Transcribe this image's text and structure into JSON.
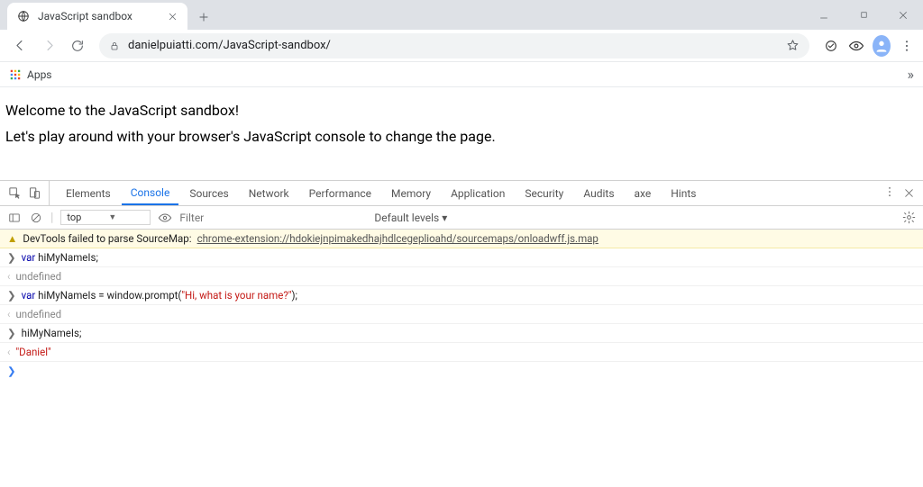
{
  "tab": {
    "title": "JavaScript sandbox"
  },
  "toolbar": {
    "url": "danielpuiatti.com/JavaScript-sandbox/"
  },
  "bookmarks": {
    "apps_label": "Apps"
  },
  "page": {
    "line1": "Welcome to the JavaScript sandbox!",
    "line2": "Let's play around with your browser's JavaScript console to change the page."
  },
  "devtools": {
    "tabs": [
      "Elements",
      "Console",
      "Sources",
      "Network",
      "Performance",
      "Memory",
      "Application",
      "Security",
      "Audits",
      "axe",
      "Hints"
    ],
    "active_tab": "Console",
    "context": "top",
    "filter_placeholder": "Filter",
    "levels": "Default levels ▾",
    "warning": {
      "prefix": "DevTools failed to parse SourceMap: ",
      "link": "chrome-extension://hdokiejnpimakedhajhdlcegeplioahd/sourcemaps/onloadwff.js.map"
    },
    "lines": [
      {
        "kind": "in",
        "code": {
          "pre": "var",
          "rest": " hiMyNameIs;"
        }
      },
      {
        "kind": "out",
        "plain": "undefined",
        "cls": "und"
      },
      {
        "kind": "in",
        "code": {
          "pre": "var",
          "rest": " hiMyNameIs = window.prompt(",
          "str": "\"Hi, what is your name?\"",
          "tail": ");"
        }
      },
      {
        "kind": "out",
        "plain": "undefined",
        "cls": "und"
      },
      {
        "kind": "in",
        "code": {
          "rest": "hiMyNameIs;"
        }
      },
      {
        "kind": "out",
        "str": "\"Daniel\""
      }
    ]
  }
}
